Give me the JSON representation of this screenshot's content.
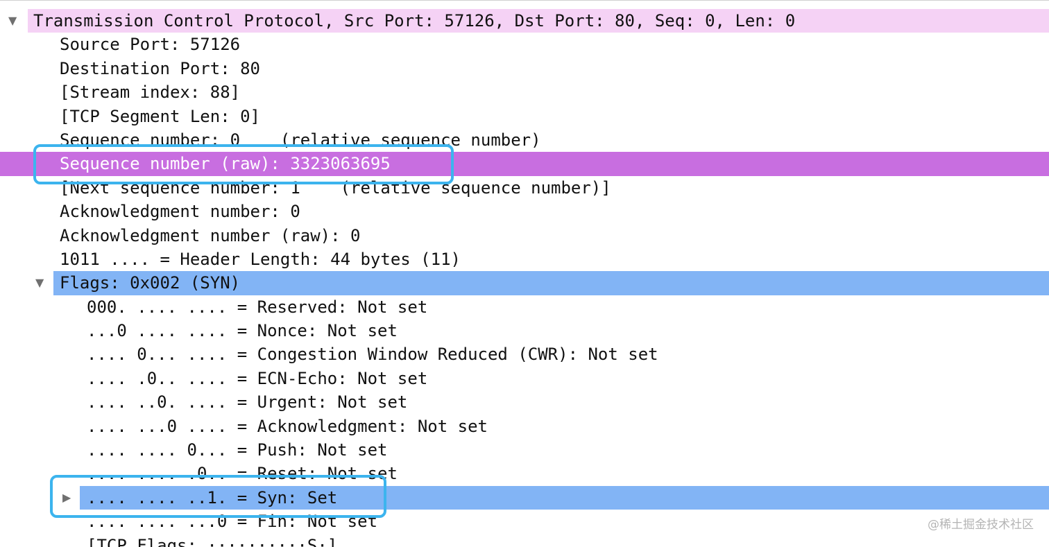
{
  "tree": {
    "tcp_header": "Transmission Control Protocol, Src Port: 57126, Dst Port: 80, Seq: 0, Len: 0",
    "fields": [
      "Source Port: 57126",
      "Destination Port: 80",
      "[Stream index: 88]",
      "[TCP Segment Len: 0]",
      "Sequence number: 0    (relative sequence number)",
      "Sequence number (raw): 3323063695",
      "[Next sequence number: 1    (relative sequence number)]",
      "Acknowledgment number: 0",
      "Acknowledgment number (raw): 0",
      "1011 .... = Header Length: 44 bytes (11)"
    ],
    "flags_header": "Flags: 0x002 (SYN)",
    "flags": [
      "000. .... .... = Reserved: Not set",
      "...0 .... .... = Nonce: Not set",
      ".... 0... .... = Congestion Window Reduced (CWR): Not set",
      ".... .0.. .... = ECN-Echo: Not set",
      ".... ..0. .... = Urgent: Not set",
      ".... ...0 .... = Acknowledgment: Not set",
      ".... .... 0... = Push: Not set",
      ".... .... .0.. = Reset: Not set",
      ".... .... ..1. = Syn: Set",
      ".... .... ...0 = Fin: Not set",
      "[TCP Flags: ··········S·]"
    ]
  },
  "icons": {
    "expanded": "triangle-down",
    "collapsed": "triangle-right"
  },
  "colors": {
    "header_highlight": "#f5d2f5",
    "selected_row": "#c86ee0",
    "flags_highlight": "#82b4f5",
    "callout": "#3cb4ee"
  },
  "watermark": "@稀土掘金技术社区"
}
